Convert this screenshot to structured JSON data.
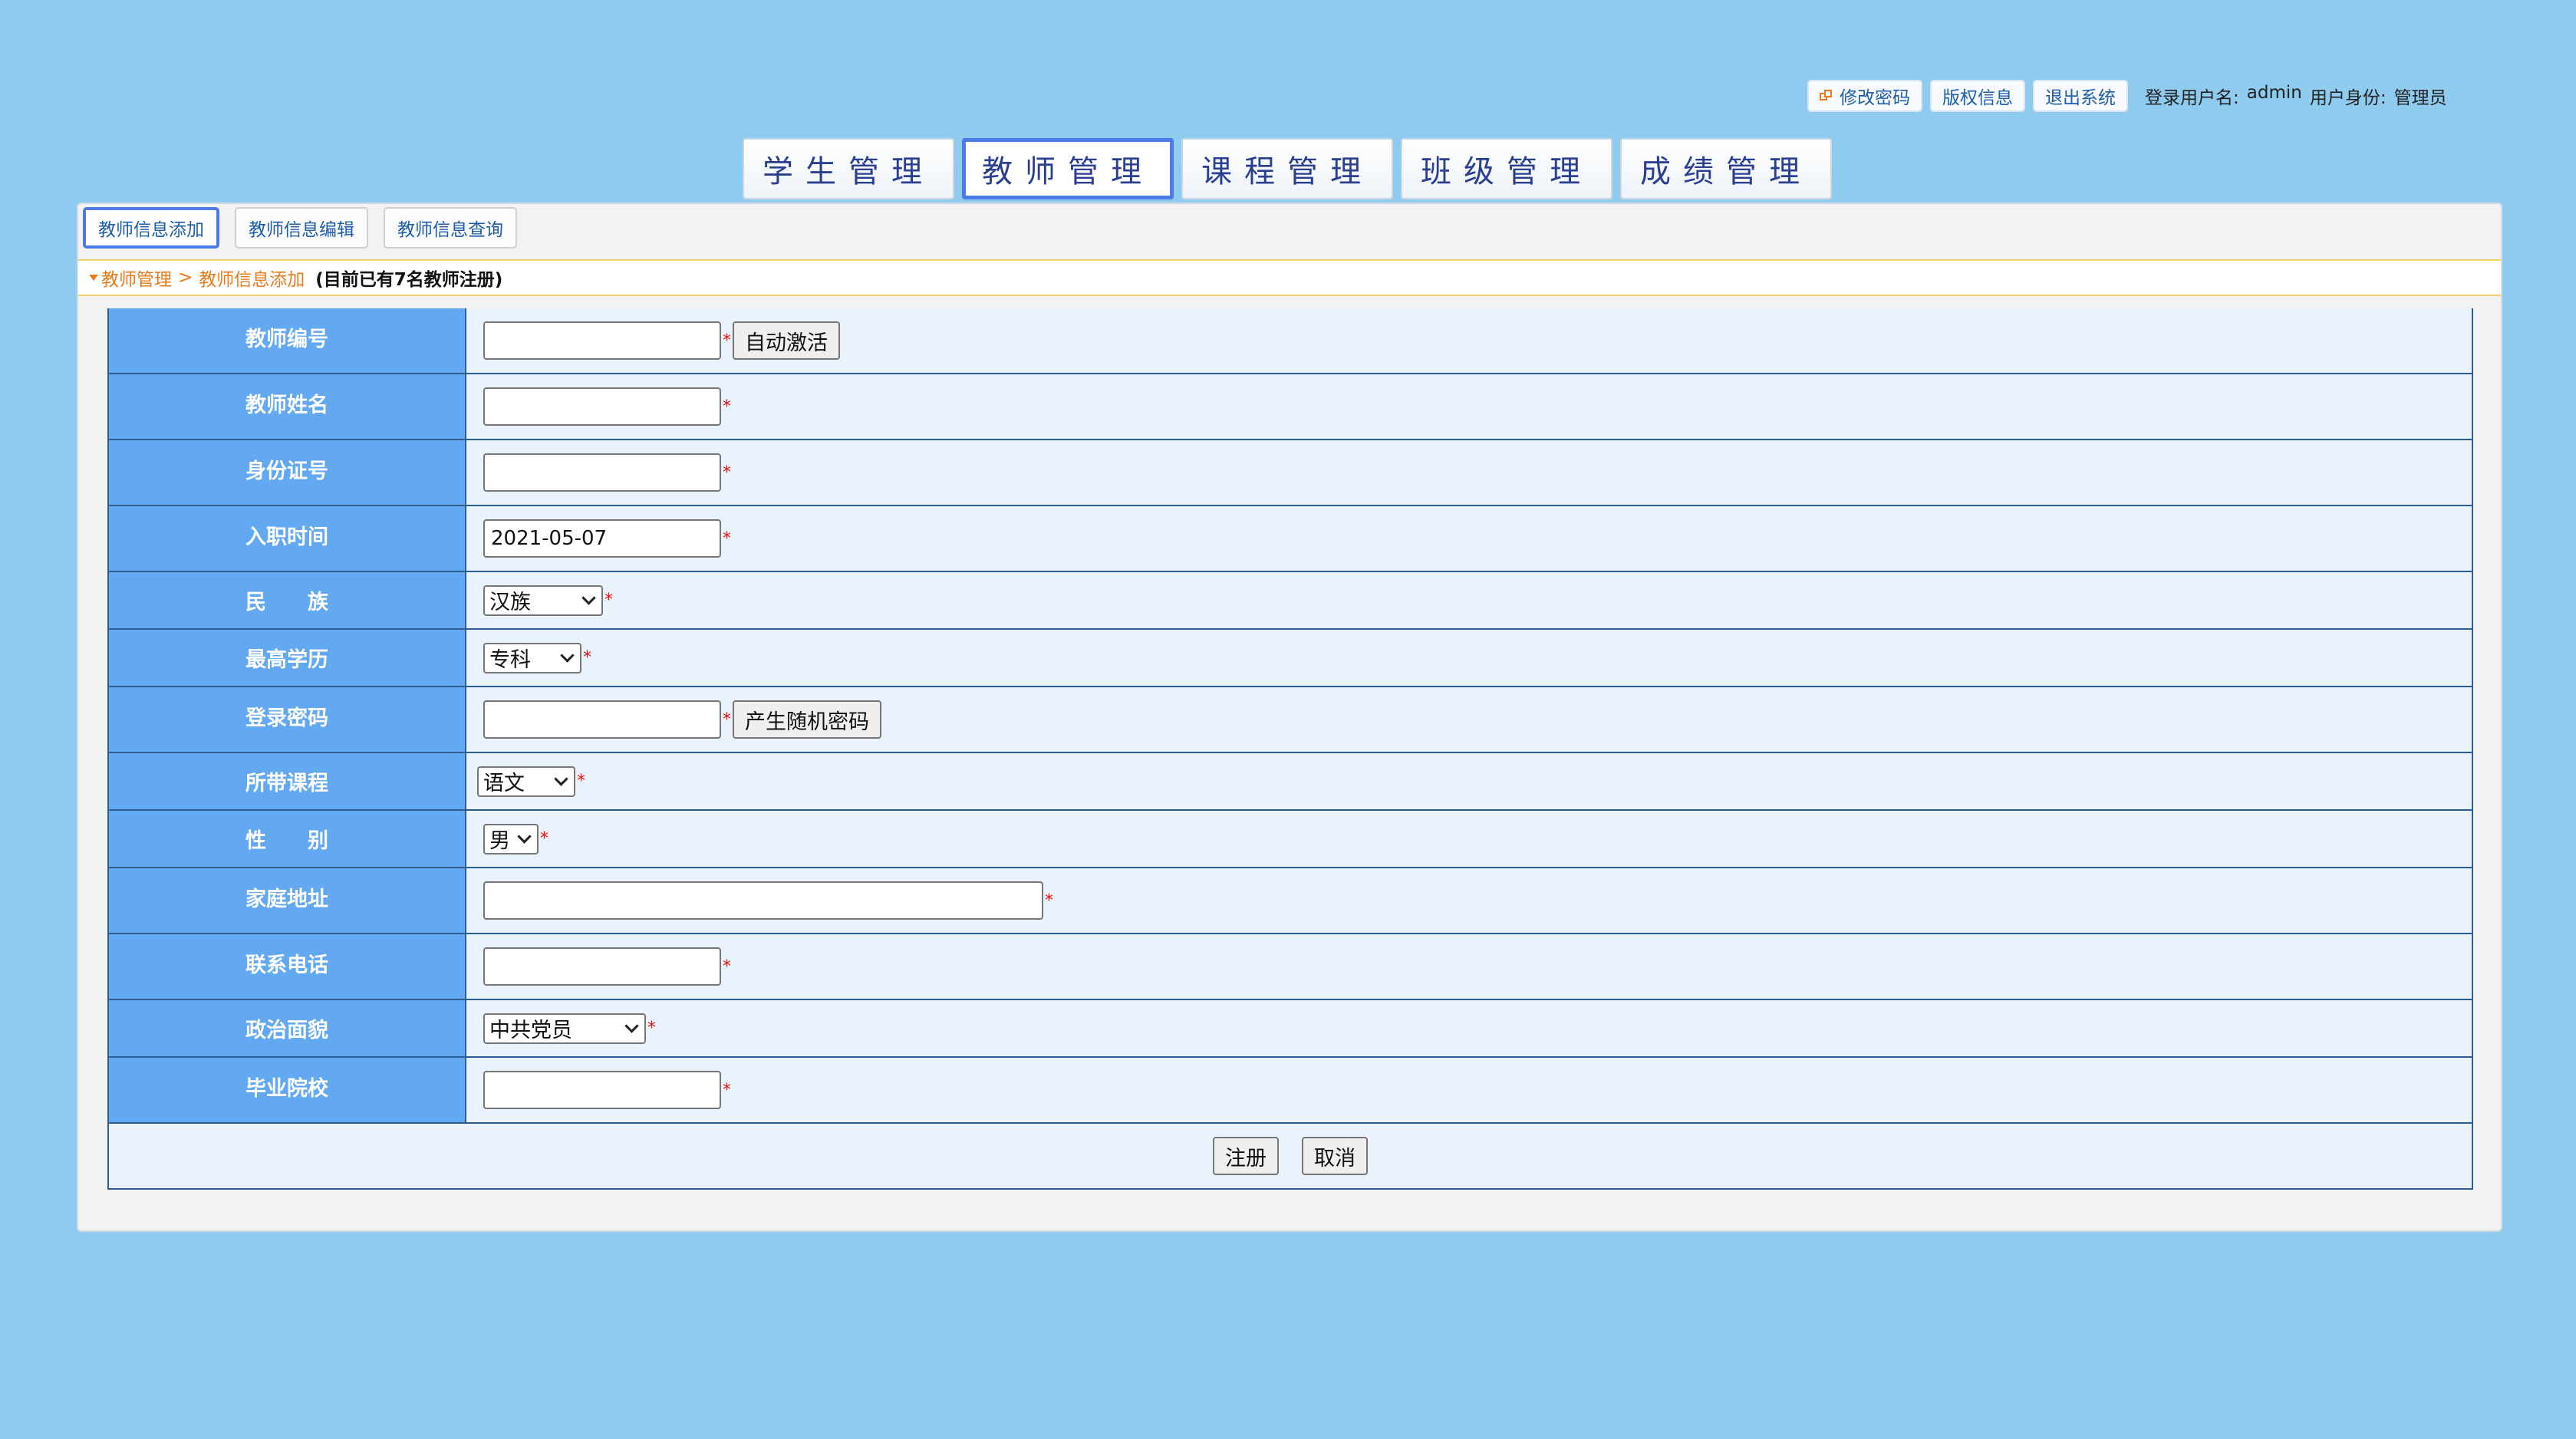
{
  "topbar": {
    "change_password": "修改密码",
    "copyright": "版权信息",
    "logout": "退出系统",
    "user_label": "登录用户名:",
    "username": "admin",
    "role_label": "用户身份:",
    "role": "管理员"
  },
  "mainnav": {
    "tabs": [
      {
        "label": "学生管理"
      },
      {
        "label": "教师管理"
      },
      {
        "label": "课程管理"
      },
      {
        "label": "班级管理"
      },
      {
        "label": "成绩管理"
      }
    ]
  },
  "subnav": {
    "tabs": [
      {
        "label": "教师信息添加"
      },
      {
        "label": "教师信息编辑"
      },
      {
        "label": "教师信息查询"
      }
    ]
  },
  "breadcrumb": {
    "parent": "教师管理",
    "separator": ">",
    "current": "教师信息添加",
    "note": "(目前已有7名教师注册)"
  },
  "form": {
    "teacher_id_label": "教师编号",
    "auto_activate": "自动激活",
    "name_label": "教师姓名",
    "id_card_label": "身份证号",
    "hire_date_label": "入职时间",
    "hire_date_value": "2021-05-07",
    "ethnicity_label": "民　　族",
    "ethnicity_value": "汉族",
    "education_label": "最高学历",
    "education_value": "专科",
    "password_label": "登录密码",
    "random_password": "产生随机密码",
    "course_label": "所带课程",
    "course_value": "语文",
    "gender_label": "性　　别",
    "gender_value": "男",
    "address_label": "家庭地址",
    "phone_label": "联系电话",
    "politics_label": "政治面貌",
    "politics_value": "中共党员",
    "school_label": "毕业院校",
    "required": "*",
    "submit": "注册",
    "cancel": "取消"
  }
}
